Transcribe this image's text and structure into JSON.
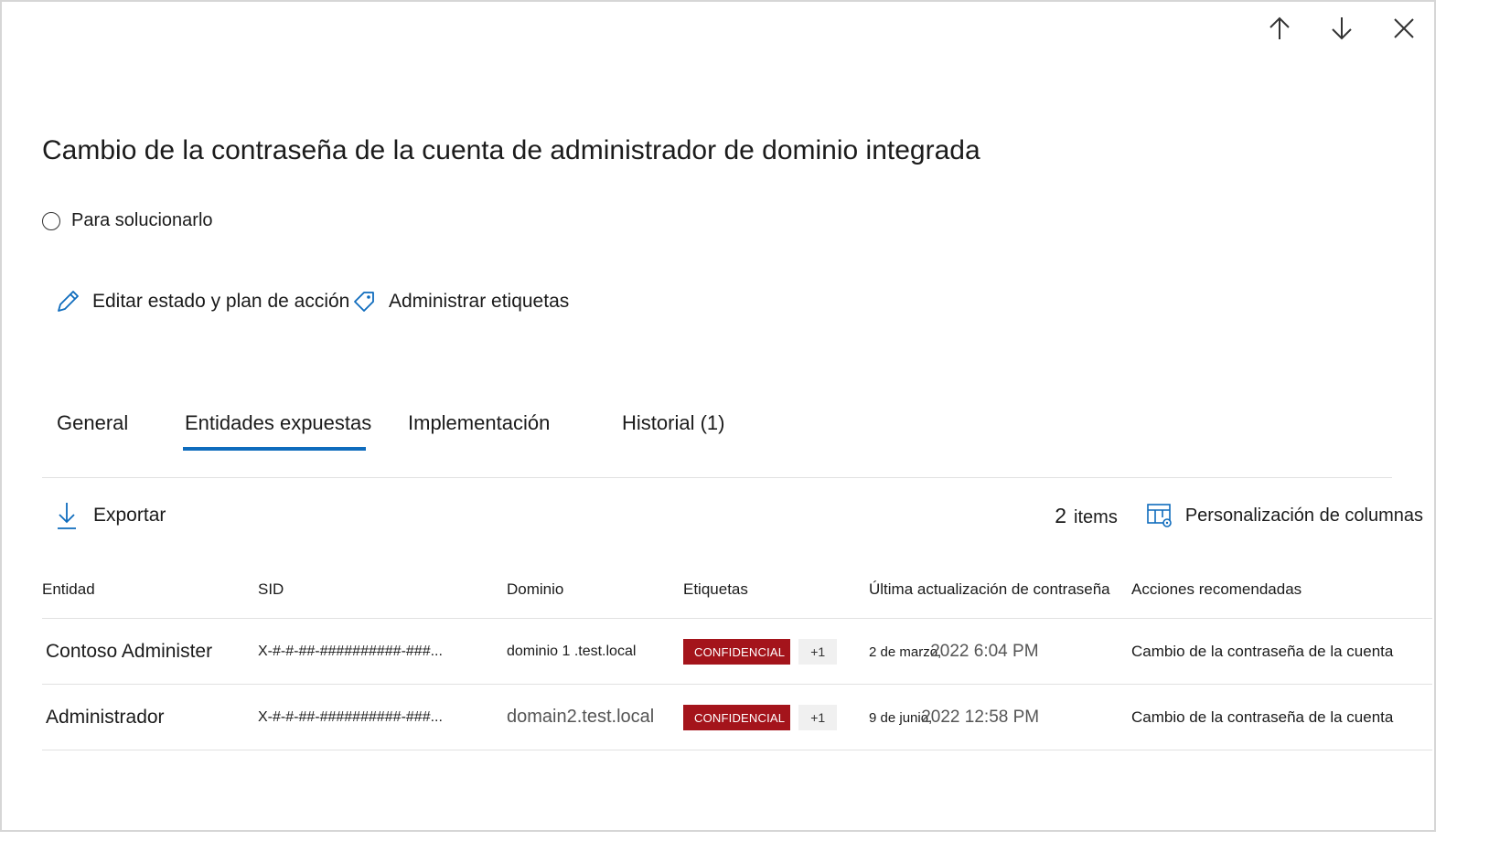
{
  "panel": {
    "title": "Cambio de la contraseña de la cuenta de administrador de dominio integrada",
    "status_label": "Para solucionarlo"
  },
  "top_actions": {
    "icons": [
      "arrow-up-icon",
      "arrow-down-icon",
      "close-icon"
    ]
  },
  "actions": {
    "edit_label": "Editar estado y plan de acción",
    "tags_label": "Administrar etiquetas"
  },
  "tabs": [
    {
      "label": "General",
      "active": false
    },
    {
      "label": "Entidades expuestas",
      "active": true
    },
    {
      "label": "Implementación",
      "active": false
    },
    {
      "label": "Historial (1)",
      "active": false
    }
  ],
  "toolbar": {
    "export_label": "Exportar",
    "count_number": "2",
    "count_label": "items",
    "customize_label": "Personalización de columnas"
  },
  "table": {
    "headers": [
      "Entidad",
      "SID",
      "Dominio",
      "Etiquetas",
      "Última actualización de contraseña",
      "Acciones recomendadas"
    ],
    "rows": [
      {
        "entity": "Contoso Administer",
        "sid": "X-#-#-##-##########-###...",
        "domain": "dominio 1 .test.local",
        "tag": "CONFIDENCIAL",
        "tag_more": "+1",
        "date_day": "2 de marzo,",
        "date_time": "2022 6:04 PM",
        "action": "Cambio de la contraseña de la cuenta"
      },
      {
        "entity": "Administrador",
        "sid": "X-#-#-##-##########-###...",
        "domain": "domain2.test.local",
        "tag": "CONFIDENCIAL",
        "tag_more": "+1",
        "date_day": "9 de junio,",
        "date_time": "2022 12:58 PM",
        "action": "Cambio de la contraseña de la cuenta"
      }
    ]
  },
  "colors": {
    "accent": "#0f6cbd",
    "badge": "#a4141b",
    "border": "#d6d6d6"
  }
}
